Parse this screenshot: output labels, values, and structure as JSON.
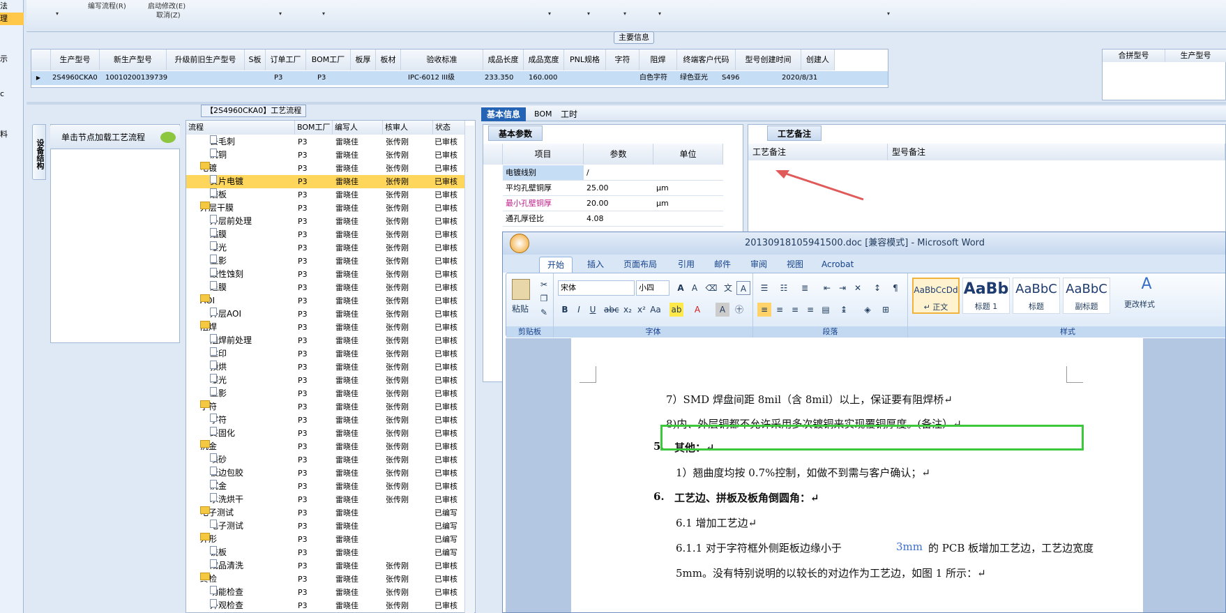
{
  "left_nav": {
    "items": [
      "法",
      "理",
      "示",
      "c",
      "料"
    ]
  },
  "toolbar": {
    "items": [
      "编写流程(R)",
      "启动修改(E)",
      "取消(Z)"
    ]
  },
  "main_info": {
    "title": "主要信息",
    "columns": [
      "生产型号",
      "新生产型号",
      "升级前旧生产型号",
      "S板",
      "订单工厂",
      "BOM工厂",
      "板厚",
      "板材",
      "验收标准",
      "成品长度",
      "成品宽度",
      "PNL规格",
      "字符",
      "阻焊",
      "终端客户代码",
      "型号创建时间",
      "创建人"
    ],
    "row": [
      "2S4960CKA0",
      "10010200139739",
      "",
      "",
      "P3",
      "P3",
      "",
      "",
      "IPC-6012 III级",
      "233.350",
      "160.000",
      "",
      "白色字符",
      "绿色亚光",
      "S496",
      "2020/8/31",
      ""
    ]
  },
  "merge_grid": {
    "columns": [
      "合拼型号",
      "生产型号"
    ]
  },
  "flow": {
    "title": "【2S4960CKA0】工艺流程",
    "side_tab": "设备结构",
    "load_button": "单击节点加载工艺流程",
    "columns": [
      "流程",
      "BOM工厂",
      "编写人",
      "核审人",
      "状态"
    ],
    "rows": [
      {
        "name": "去毛刺",
        "level": 2,
        "bom": "P3",
        "writer": "雷晓佳",
        "checker": "张传刚",
        "status": "已审核"
      },
      {
        "name": "沉铜",
        "level": 2,
        "bom": "P3",
        "writer": "雷晓佳",
        "checker": "张传刚",
        "status": "已审核"
      },
      {
        "name": "电镀",
        "level": 1,
        "bom": "P3",
        "writer": "雷晓佳",
        "checker": "张传刚",
        "status": "已审核"
      },
      {
        "name": "负片电镀",
        "level": 2,
        "bom": "P3",
        "writer": "雷晓佳",
        "checker": "张传刚",
        "status": "已审核",
        "selected": true
      },
      {
        "name": "磨板",
        "level": 2,
        "bom": "P3",
        "writer": "雷晓佳",
        "checker": "张传刚",
        "status": "已审核"
      },
      {
        "name": "外层干膜",
        "level": 1,
        "bom": "P3",
        "writer": "雷晓佳",
        "checker": "张传刚",
        "status": "已审核"
      },
      {
        "name": "外层前处理",
        "level": 2,
        "bom": "P3",
        "writer": "雷晓佳",
        "checker": "张传刚",
        "status": "已审核"
      },
      {
        "name": "贴膜",
        "level": 2,
        "bom": "P3",
        "writer": "雷晓佳",
        "checker": "张传刚",
        "status": "已审核"
      },
      {
        "name": "曝光",
        "level": 2,
        "bom": "P3",
        "writer": "雷晓佳",
        "checker": "张传刚",
        "status": "已审核"
      },
      {
        "name": "显影",
        "level": 2,
        "bom": "P3",
        "writer": "雷晓佳",
        "checker": "张传刚",
        "status": "已审核"
      },
      {
        "name": "酸性蚀刻",
        "level": 2,
        "bom": "P3",
        "writer": "雷晓佳",
        "checker": "张传刚",
        "status": "已审核"
      },
      {
        "name": "退膜",
        "level": 2,
        "bom": "P3",
        "writer": "雷晓佳",
        "checker": "张传刚",
        "status": "已审核"
      },
      {
        "name": "AOI",
        "level": 1,
        "bom": "P3",
        "writer": "雷晓佳",
        "checker": "张传刚",
        "status": "已审核"
      },
      {
        "name": "外层AOI",
        "level": 2,
        "bom": "P3",
        "writer": "雷晓佳",
        "checker": "张传刚",
        "status": "已审核"
      },
      {
        "name": "阻焊",
        "level": 1,
        "bom": "P3",
        "writer": "雷晓佳",
        "checker": "张传刚",
        "status": "已审核"
      },
      {
        "name": "阻焊前处理",
        "level": 2,
        "bom": "P3",
        "writer": "雷晓佳",
        "checker": "张传刚",
        "status": "已审核"
      },
      {
        "name": "丝印",
        "level": 2,
        "bom": "P3",
        "writer": "雷晓佳",
        "checker": "张传刚",
        "status": "已审核"
      },
      {
        "name": "预烘",
        "level": 2,
        "bom": "P3",
        "writer": "雷晓佳",
        "checker": "张传刚",
        "status": "已审核"
      },
      {
        "name": "曝光",
        "level": 2,
        "bom": "P3",
        "writer": "雷晓佳",
        "checker": "张传刚",
        "status": "已审核"
      },
      {
        "name": "显影",
        "level": 2,
        "bom": "P3",
        "writer": "雷晓佳",
        "checker": "张传刚",
        "status": "已审核"
      },
      {
        "name": "字符",
        "level": 1,
        "bom": "P3",
        "writer": "雷晓佳",
        "checker": "张传刚",
        "status": "已审核"
      },
      {
        "name": "字符",
        "level": 2,
        "bom": "P3",
        "writer": "雷晓佳",
        "checker": "张传刚",
        "status": "已审核"
      },
      {
        "name": "终固化",
        "level": 2,
        "bom": "P3",
        "writer": "雷晓佳",
        "checker": "张传刚",
        "status": "已审核"
      },
      {
        "name": "沉金",
        "level": 1,
        "bom": "P3",
        "writer": "雷晓佳",
        "checker": "张传刚",
        "status": "已审核"
      },
      {
        "name": "喷砂",
        "level": 2,
        "bom": "P3",
        "writer": "雷晓佳",
        "checker": "张传刚",
        "status": "已审核"
      },
      {
        "name": "板边包胶",
        "level": 2,
        "bom": "P3",
        "writer": "雷晓佳",
        "checker": "张传刚",
        "status": "已审核"
      },
      {
        "name": "沉金",
        "level": 2,
        "bom": "P3",
        "writer": "雷晓佳",
        "checker": "张传刚",
        "status": "已审核"
      },
      {
        "name": "水洗烘干",
        "level": 2,
        "bom": "P3",
        "writer": "雷晓佳",
        "checker": "张传刚",
        "status": "已审核"
      },
      {
        "name": "电子测试",
        "level": 1,
        "bom": "P3",
        "writer": "雷晓佳",
        "checker": "",
        "status": "已编写"
      },
      {
        "name": "电子测试",
        "level": 2,
        "bom": "P3",
        "writer": "雷晓佳",
        "checker": "",
        "status": "已编写"
      },
      {
        "name": "外形",
        "level": 1,
        "bom": "P3",
        "writer": "雷晓佳",
        "checker": "",
        "status": "已编写"
      },
      {
        "name": "铣板",
        "level": 2,
        "bom": "P3",
        "writer": "雷晓佳",
        "checker": "",
        "status": "已编写"
      },
      {
        "name": "成品清洗",
        "level": 2,
        "bom": "P3",
        "writer": "雷晓佳",
        "checker": "张传刚",
        "status": "已审核"
      },
      {
        "name": "终检",
        "level": 1,
        "bom": "P3",
        "writer": "雷晓佳",
        "checker": "张传刚",
        "status": "已审核"
      },
      {
        "name": "功能检查",
        "level": 2,
        "bom": "P3",
        "writer": "雷晓佳",
        "checker": "张传刚",
        "status": "已审核"
      },
      {
        "name": "外观检查",
        "level": 2,
        "bom": "P3",
        "writer": "雷晓佳",
        "checker": "张传刚",
        "status": "已审核"
      }
    ]
  },
  "detail_tabs": [
    "基本信息",
    "BOM",
    "工时"
  ],
  "params": {
    "title": "基本参数",
    "columns": [
      "项目",
      "参数",
      "单位"
    ],
    "rows": [
      {
        "item": "电镀线别",
        "value": "/",
        "unit": ""
      },
      {
        "item": "平均孔壁铜厚",
        "value": "25.00",
        "unit": "μm"
      },
      {
        "item": "最小孔壁铜厚",
        "value": "20.00",
        "unit": "μm"
      },
      {
        "item": "通孔厚径比",
        "value": "4.08",
        "unit": ""
      }
    ]
  },
  "remark": {
    "title": "工艺备注",
    "columns": [
      "工艺备注",
      "型号备注"
    ]
  },
  "word": {
    "title": "20130918105941500.doc [兼容模式] - Microsoft Word",
    "tabs": [
      "开始",
      "插入",
      "页面布局",
      "引用",
      "邮件",
      "审阅",
      "视图",
      "Acrobat"
    ],
    "font": "宋体",
    "size": "小四",
    "groups": [
      "剪贴板",
      "字体",
      "段落",
      "样式"
    ],
    "paste": "粘贴",
    "change_styles": "更改样式",
    "styles": [
      {
        "sample": "AaBbCcDd",
        "name": "↵ 正文"
      },
      {
        "sample": "AaBb",
        "name": "标题 1"
      },
      {
        "sample": "AaBbC",
        "name": "标题"
      },
      {
        "sample": "AaBbC",
        "name": "副标题"
      }
    ],
    "lines": [
      "7）SMD 焊盘间距 8mil（含 8mil）以上，保证要有阻焊桥↵",
      "8)内、外层铜都不允许采用多次镀铜来实现覆铜厚度。(备注）↵",
      "5.",
      "其他：↵",
      "1）翘曲度均按 0.7%控制，如做不到需与客户确认；↵",
      "6.",
      "工艺边、拼板及板角倒圆角：↵",
      "6.1 增加工艺边↵",
      "6.1.1 对于字符框外侧距板边缘小于",
      "3mm",
      "的 PCB 板增加工艺边，工艺边宽度",
      "5mm。没有特别说明的以较长的对边作为工艺边，如图 1 所示：↵"
    ]
  },
  "colors": {
    "accent": "#2563b4",
    "selection": "#ffd65c",
    "highlight_box": "#3cc83c",
    "arrow": "#e05a5a",
    "link_blue": "#3b6fd1",
    "pink_text": "#c0208a"
  }
}
